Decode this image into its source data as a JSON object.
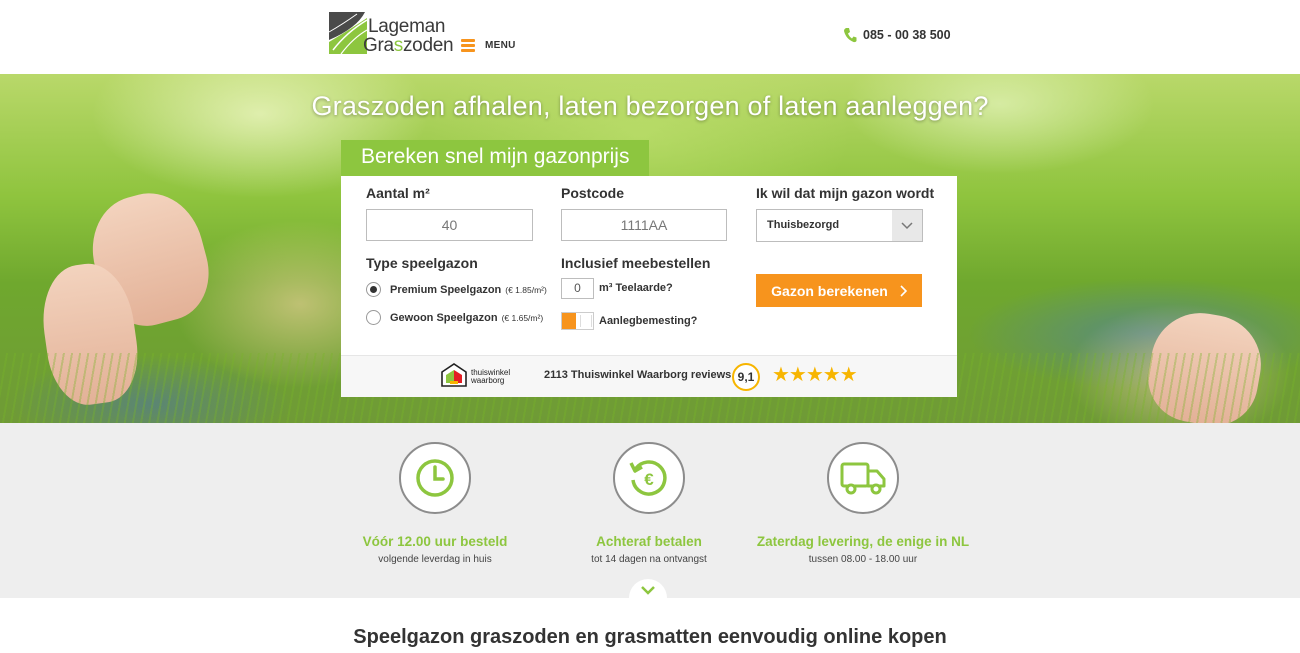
{
  "header": {
    "logo_line1": "Lageman",
    "logo_line2_dark": "Gra",
    "logo_line2_green": "s",
    "logo_line2_rest": "zoden",
    "menu_label": "MENU",
    "phone": "085 - 00 38 500"
  },
  "hero": {
    "title": "Graszoden afhalen, laten bezorgen of laten aanleggen?"
  },
  "calculator": {
    "tab_title": "Bereken snel mijn gazonprijs",
    "area_label": "Aantal m²",
    "area_value": "40",
    "postcode_label": "Postcode",
    "postcode_placeholder": "1111AA",
    "delivery_label": "Ik wil dat mijn gazon wordt",
    "delivery_selected": "Thuisbezorgd",
    "type_label": "Type speelgazon",
    "types": [
      {
        "label": "Premium Speelgazon",
        "price": "(€ 1.85/m²)",
        "checked": true
      },
      {
        "label": "Gewoon Speelgazon",
        "price": "(€ 1.65/m²)",
        "checked": false
      }
    ],
    "extras_label": "Inclusief meebestellen",
    "soil_qty": "0",
    "soil_label": "m³ Teelaarde?",
    "fertilizer_label": "Aanlegbemesting?",
    "submit_label": "Gazon berekenen"
  },
  "reviews": {
    "badge_line1": "thuiswinkel",
    "badge_line2": "waarborg",
    "count_text": "2113 Thuiswinkel Waarborg reviews",
    "score": "9,1",
    "stars": "★★★★★",
    "rating_out_of_5": 4.55
  },
  "features": [
    {
      "icon": "clock-icon",
      "title": "Vóór 12.00 uur besteld",
      "subtitle": "volgende leverdag in huis"
    },
    {
      "icon": "euro-refresh-icon",
      "title": "Achteraf betalen",
      "subtitle": "tot 14 dagen na ontvangst"
    },
    {
      "icon": "truck-icon",
      "title": "Zaterdag levering, de enige in NL",
      "subtitle": "tussen 08.00 - 18.00 uur"
    }
  ],
  "section": {
    "title": "Speelgazon graszoden en grasmatten eenvoudig online kopen"
  },
  "colors": {
    "green": "#8dc63f",
    "orange": "#f7941d",
    "star": "#f7b500"
  }
}
